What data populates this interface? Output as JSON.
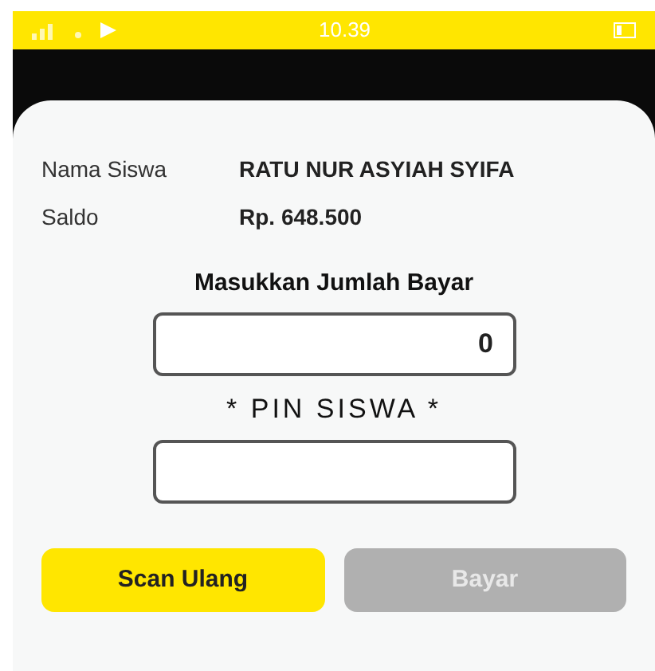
{
  "status_bar": {
    "time": "10.39"
  },
  "info": [
    {
      "label": "Nama Siswa",
      "value": "RATU NUR ASYIAH SYIFA"
    },
    {
      "label": "Saldo",
      "value": "Rp. 648.500"
    }
  ],
  "amount": {
    "label": "Masukkan Jumlah Bayar",
    "value": "0"
  },
  "pin": {
    "label": "* PIN SISWA *"
  },
  "buttons": [
    {
      "label": "Scan Ulang",
      "disabled": false
    },
    {
      "label": "Bayar",
      "disabled": true
    }
  ]
}
